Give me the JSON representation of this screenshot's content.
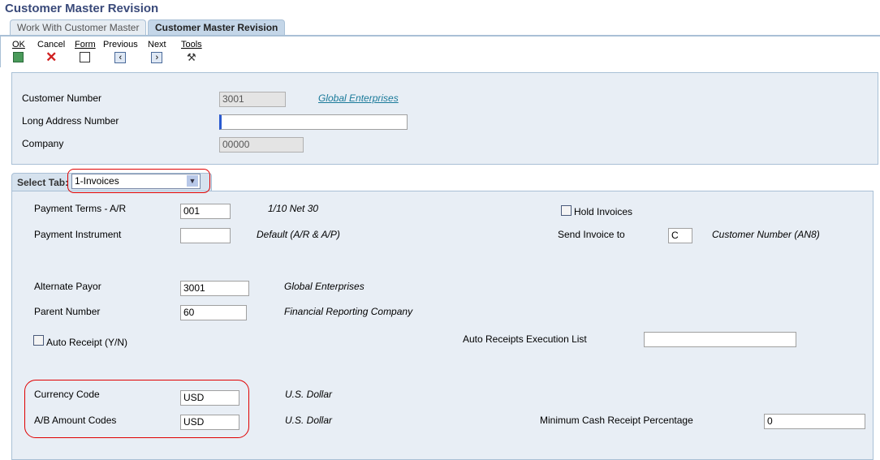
{
  "window_title": "Customer Master Revision",
  "tabs": [
    "Work With Customer Master",
    "Customer Master Revision"
  ],
  "toolbar": {
    "ok": "OK",
    "cancel": "Cancel",
    "form": "Form",
    "previous": "Previous",
    "next": "Next",
    "tools": "Tools"
  },
  "header": {
    "customer_number_label": "Customer Number",
    "customer_number": "3001",
    "customer_name_link": "Global Enterprises",
    "long_address_label": "Long Address Number",
    "long_address": "",
    "company_label": "Company",
    "company": "00000"
  },
  "select_tab": {
    "label": "Select Tab:",
    "value": "1-Invoices"
  },
  "invoices": {
    "payment_terms_label": "Payment Terms - A/R",
    "payment_terms": "001",
    "payment_terms_desc": "1/10 Net 30",
    "payment_instrument_label": "Payment Instrument",
    "payment_instrument": "",
    "payment_instrument_desc": "Default (A/R & A/P)",
    "hold_invoices_label": "Hold Invoices",
    "hold_invoices": false,
    "send_invoice_label": "Send Invoice to",
    "send_invoice": "C",
    "send_invoice_desc": "Customer Number (AN8)",
    "alternate_payor_label": "Alternate Payor",
    "alternate_payor": "3001",
    "alternate_payor_desc": "Global Enterprises",
    "parent_number_label": "Parent Number",
    "parent_number": "60",
    "parent_number_desc": "Financial Reporting Company",
    "auto_receipt_label": "Auto Receipt (Y/N)",
    "auto_receipt": false,
    "auto_receipts_list_label": "Auto Receipts Execution List",
    "auto_receipts_list": "",
    "currency_code_label": "Currency Code",
    "currency_code": "USD",
    "currency_code_desc": "U.S. Dollar",
    "ab_amount_label": "A/B Amount Codes",
    "ab_amount": "USD",
    "ab_amount_desc": "U.S. Dollar",
    "min_cash_label": "Minimum Cash Receipt Percentage",
    "min_cash": "0"
  }
}
